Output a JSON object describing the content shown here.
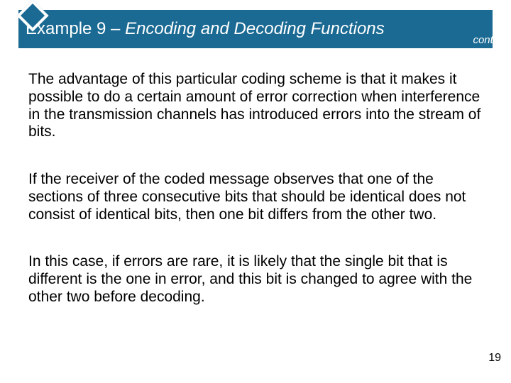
{
  "title": {
    "prefix": "Example 9 – ",
    "emph": "Encoding and Decoding Functions",
    "contd": "cont'd"
  },
  "paragraphs": {
    "p1": "The advantage of this particular coding scheme is that it makes it possible to do a certain amount of error correction when interference in the transmission channels has introduced errors into the stream of bits.",
    "p2": "If the receiver of the coded message observes that one of the sections of three consecutive bits that should be identical does not consist of identical bits, then one bit differs from the other two.",
    "p3": "In this case, if errors are rare, it is likely that the single bit that is different is the one in error, and this bit is changed to agree with the other two before decoding."
  },
  "page_number": "19"
}
